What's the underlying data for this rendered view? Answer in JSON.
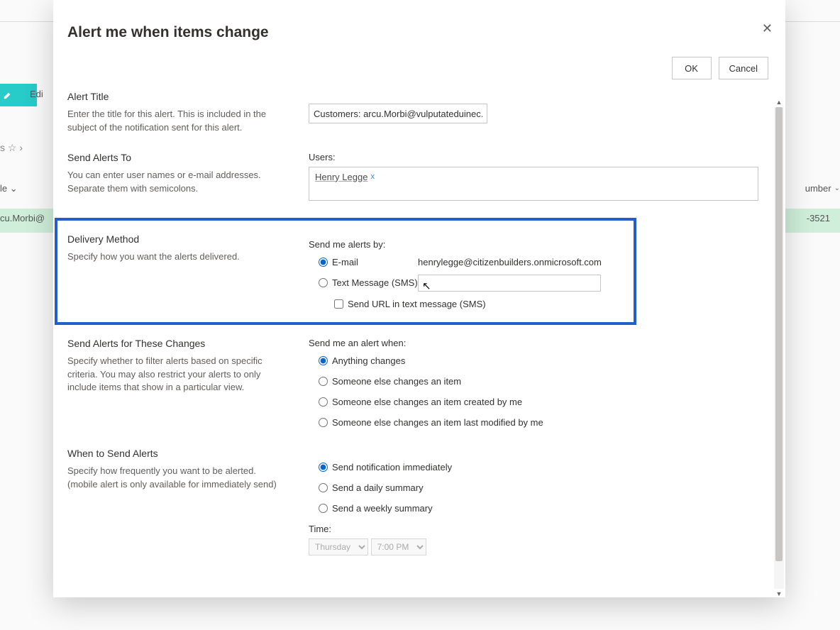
{
  "background": {
    "edit_label": "Edi",
    "star_row": "s  ☆  ›",
    "col_le": "le  ⌄",
    "col_number": "umber",
    "row_email": "cu.Morbi@",
    "row_phone": "-3521"
  },
  "modal": {
    "title": "Alert me when items change",
    "buttons": {
      "ok": "OK",
      "cancel": "Cancel"
    },
    "sections": {
      "alert_title": {
        "heading": "Alert Title",
        "desc": "Enter the title for this alert. This is included in the subject of the notification sent for this alert.",
        "value": "Customers: arcu.Morbi@vulputateduinec."
      },
      "send_to": {
        "heading": "Send Alerts To",
        "desc": "You can enter user names or e-mail addresses. Separate them with semicolons.",
        "users_label": "Users:",
        "user": {
          "name": "Henry Legge",
          "remove": "x"
        }
      },
      "delivery": {
        "heading": "Delivery Method",
        "desc": "Specify how you want the alerts delivered.",
        "send_by_label": "Send me alerts by:",
        "email_label": "E-mail",
        "email_value": "henrylegge@citizenbuilders.onmicrosoft.com",
        "sms_label": "Text Message (SMS)",
        "send_url_label": "Send URL in text message (SMS)"
      },
      "changes": {
        "heading": "Send Alerts for These Changes",
        "desc": "Specify whether to filter alerts based on specific criteria. You may also restrict your alerts to only include items that show in a particular view.",
        "when_label": "Send me an alert when:",
        "options": [
          "Anything changes",
          "Someone else changes an item",
          "Someone else changes an item created by me",
          "Someone else changes an item last modified by me"
        ]
      },
      "when": {
        "heading": "When to Send Alerts",
        "desc": "Specify how frequently you want to be alerted. (mobile alert is only available for immediately send)",
        "options": [
          "Send notification immediately",
          "Send a daily summary",
          "Send a weekly summary"
        ],
        "time_label": "Time:",
        "day": "Thursday",
        "hour": "7:00 PM"
      }
    }
  }
}
